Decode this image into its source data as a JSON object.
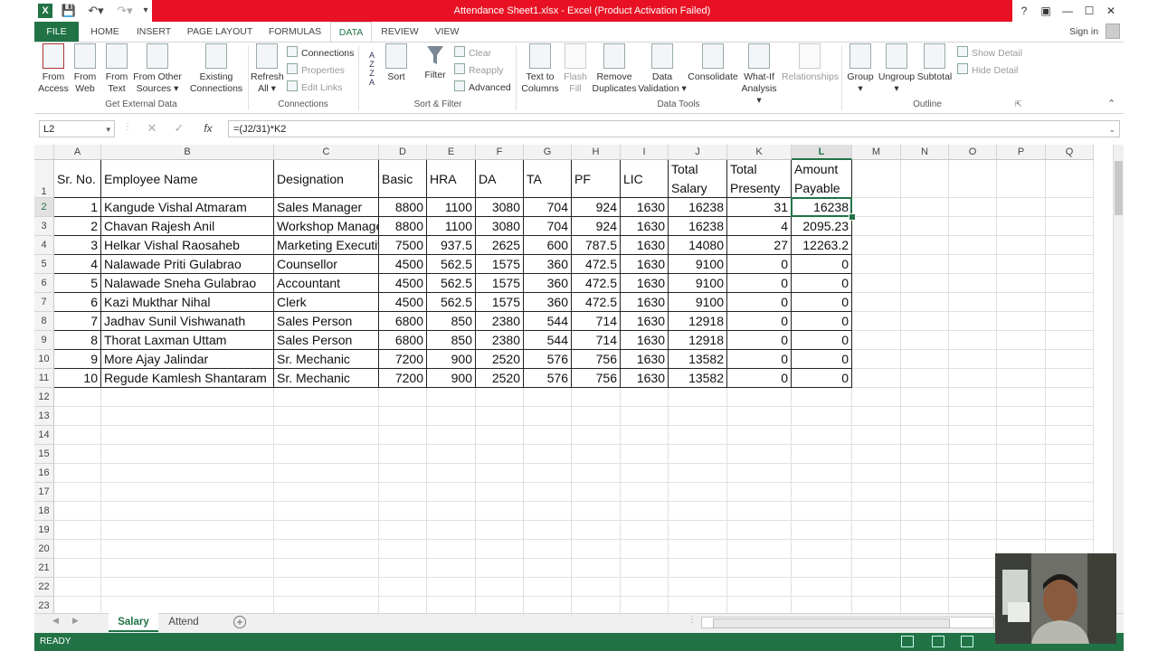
{
  "window": {
    "title": "Attendance Sheet1.xlsx -  Excel (Product Activation Failed)",
    "sign_in": "Sign in",
    "help": "?"
  },
  "tabs": [
    "FILE",
    "HOME",
    "INSERT",
    "PAGE LAYOUT",
    "FORMULAS",
    "DATA",
    "REVIEW",
    "VIEW"
  ],
  "ribbon": {
    "get_external": {
      "label": "Get External Data",
      "from_access": [
        "From",
        "Access"
      ],
      "from_web": [
        "From",
        "Web"
      ],
      "from_text": [
        "From",
        "Text"
      ],
      "from_other": [
        "From Other",
        "Sources ▾"
      ],
      "existing": [
        "Existing",
        "Connections"
      ]
    },
    "connections": {
      "label": "Connections",
      "refresh": [
        "Refresh",
        "All ▾"
      ],
      "connections": "Connections",
      "properties": "Properties",
      "edit_links": "Edit Links"
    },
    "sort_filter": {
      "label": "Sort & Filter",
      "sort": "Sort",
      "filter": "Filter",
      "clear": "Clear",
      "reapply": "Reapply",
      "advanced": "Advanced"
    },
    "data_tools": {
      "label": "Data Tools",
      "text_to_columns": [
        "Text to",
        "Columns"
      ],
      "flash_fill": [
        "Flash",
        "Fill"
      ],
      "remove_duplicates": [
        "Remove",
        "Duplicates"
      ],
      "data_validation": [
        "Data",
        "Validation ▾"
      ],
      "consolidate": "Consolidate",
      "what_if": [
        "What-If",
        "Analysis ▾"
      ],
      "relationships": "Relationships"
    },
    "outline": {
      "label": "Outline",
      "group": [
        "Group",
        "▾"
      ],
      "ungroup": [
        "Ungroup",
        "▾"
      ],
      "subtotal": "Subtotal",
      "show_detail": "Show Detail",
      "hide_detail": "Hide Detail"
    }
  },
  "formula_bar": {
    "name_box": "L2",
    "fx": "fx",
    "formula": "=(J2/31)*K2"
  },
  "columns": [
    "A",
    "B",
    "C",
    "D",
    "E",
    "F",
    "G",
    "H",
    "I",
    "J",
    "K",
    "L",
    "M",
    "N",
    "O",
    "P",
    "Q"
  ],
  "header_row": {
    "a": "Sr. No.",
    "b": "Employee Name",
    "c": "Designation",
    "d": "Basic",
    "e": "HRA",
    "f": "DA",
    "g": "TA",
    "h": "PF",
    "i": "LIC",
    "j": [
      "Total",
      "Salary"
    ],
    "k": [
      "Total",
      "Presenty"
    ],
    "l": [
      "Amount",
      "Payable"
    ]
  },
  "rows": [
    [
      "1",
      "Kangude Vishal Atmaram",
      "Sales Manager",
      "8800",
      "1100",
      "3080",
      "704",
      "924",
      "1630",
      "16238",
      "31",
      "16238"
    ],
    [
      "2",
      "Chavan Rajesh Anil",
      "Workshop Manager",
      "8800",
      "1100",
      "3080",
      "704",
      "924",
      "1630",
      "16238",
      "4",
      "2095.23"
    ],
    [
      "3",
      "Helkar Vishal Raosaheb",
      "Marketing Executive",
      "7500",
      "937.5",
      "2625",
      "600",
      "787.5",
      "1630",
      "14080",
      "27",
      "12263.2"
    ],
    [
      "4",
      "Nalawade Priti Gulabrao",
      "Counsellor",
      "4500",
      "562.5",
      "1575",
      "360",
      "472.5",
      "1630",
      "9100",
      "0",
      "0"
    ],
    [
      "5",
      "Nalawade Sneha Gulabrao",
      "Accountant",
      "4500",
      "562.5",
      "1575",
      "360",
      "472.5",
      "1630",
      "9100",
      "0",
      "0"
    ],
    [
      "6",
      "Kazi Mukthar Nihal",
      "Clerk",
      "4500",
      "562.5",
      "1575",
      "360",
      "472.5",
      "1630",
      "9100",
      "0",
      "0"
    ],
    [
      "7",
      "Jadhav Sunil Vishwanath",
      "Sales Person",
      "6800",
      "850",
      "2380",
      "544",
      "714",
      "1630",
      "12918",
      "0",
      "0"
    ],
    [
      "8",
      "Thorat Laxman Uttam",
      "Sales Person",
      "6800",
      "850",
      "2380",
      "544",
      "714",
      "1630",
      "12918",
      "0",
      "0"
    ],
    [
      "9",
      "More Ajay Jalindar",
      "Sr. Mechanic",
      "7200",
      "900",
      "2520",
      "576",
      "756",
      "1630",
      "13582",
      "0",
      "0"
    ],
    [
      "10",
      "Regude Kamlesh Shantaram",
      "Sr. Mechanic",
      "7200",
      "900",
      "2520",
      "576",
      "756",
      "1630",
      "13582",
      "0",
      "0"
    ]
  ],
  "row_numbers": [
    "1",
    "2",
    "3",
    "4",
    "5",
    "6",
    "7",
    "8",
    "9",
    "10",
    "11",
    "12",
    "13",
    "14",
    "15",
    "16",
    "17",
    "18",
    "19",
    "20",
    "21",
    "22",
    "23"
  ],
  "sheets": [
    "Salary",
    "Attend"
  ],
  "status": {
    "ready": "READY"
  },
  "colors": {
    "excel_green": "#217346",
    "title_red": "#e81123"
  }
}
